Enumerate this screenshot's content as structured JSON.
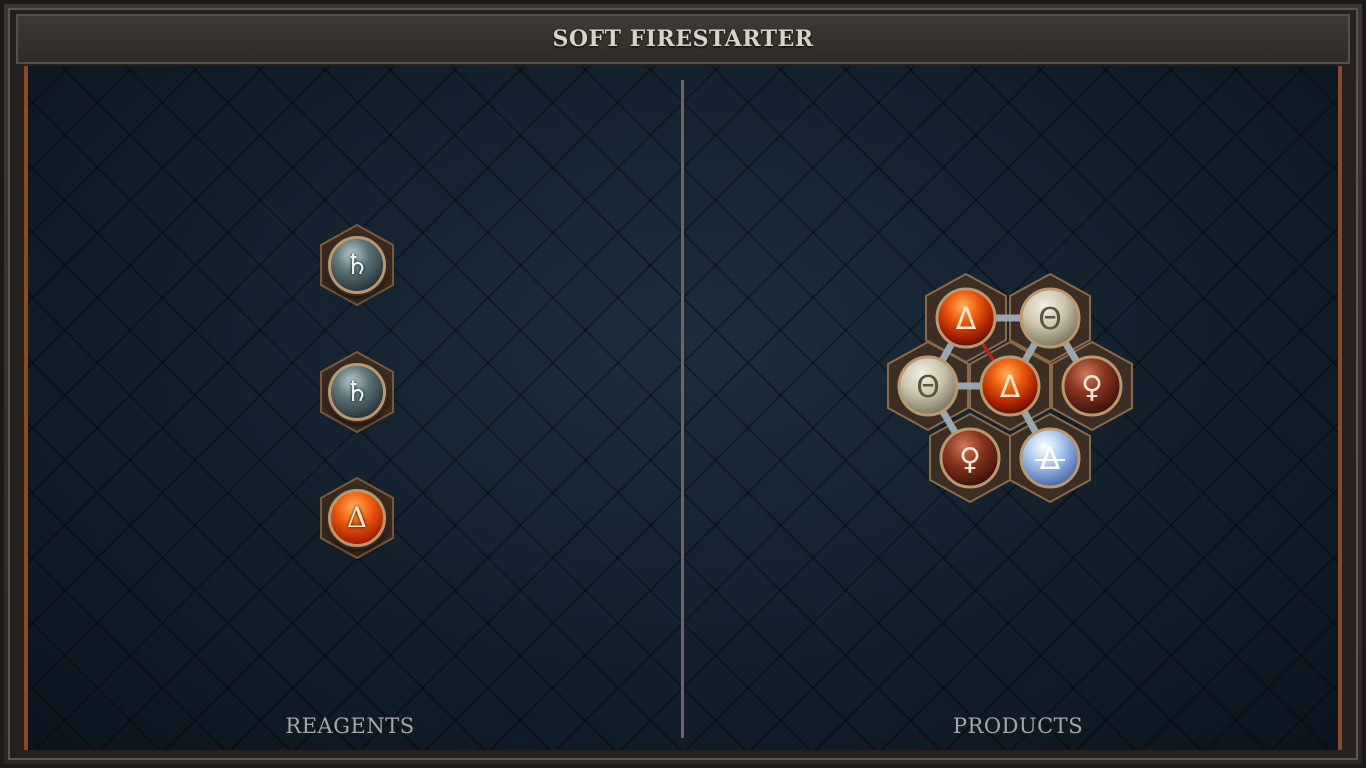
{
  "title": "SOFT FIRESTARTER",
  "reagents_label": "REAGENTS",
  "products_label": "PRODUCTS",
  "reagents": [
    {
      "element": "salt",
      "glyph": "♄"
    },
    {
      "element": "salt",
      "glyph": "♄"
    },
    {
      "element": "fire",
      "glyph": "Δ"
    }
  ],
  "product_atoms": [
    {
      "element": "fire",
      "glyph": "Δ"
    },
    {
      "element": "air",
      "glyph": "Θ"
    },
    {
      "element": "air",
      "glyph": "Θ"
    },
    {
      "element": "fire",
      "glyph": "Δ"
    },
    {
      "element": "copper",
      "glyph": "♀"
    },
    {
      "element": "copper",
      "glyph": "♀"
    },
    {
      "element": "water",
      "glyph": "Δ"
    }
  ],
  "colors": {
    "frame": "#2b2724",
    "board": "#0f1b25",
    "accent_trim": "#8a4a26",
    "label_text": "#a6a7a6",
    "title_text": "#d9d3c6"
  }
}
